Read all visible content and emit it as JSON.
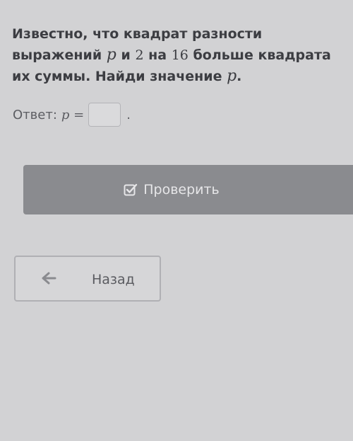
{
  "task": {
    "part1": "Известно, что квадрат разности выражений ",
    "var1": "p",
    "part2": " и ",
    "num2": "2",
    "part3": " на ",
    "num16": "16",
    "part4": " больше квадрата их суммы. Найди значение ",
    "var2": "p",
    "part5": "."
  },
  "answer": {
    "label": "Ответ:",
    "expression": "p =",
    "value": "",
    "trail": "."
  },
  "buttons": {
    "check_label": "Проверить",
    "back_label": "Назад"
  },
  "icons": {
    "check": "checkbox-icon",
    "back": "arrow-left-icon"
  },
  "colors": {
    "check_button": "#8a8b8f",
    "back_arrow": "#8a8b8f"
  }
}
